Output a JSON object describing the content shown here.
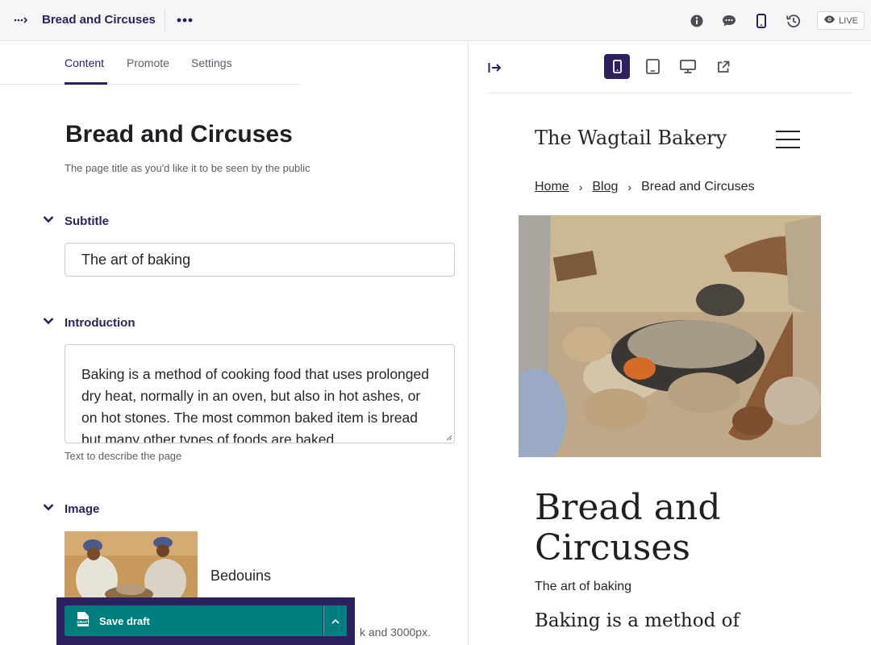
{
  "header": {
    "page_name": "Bread and Circuses",
    "live_label": "LIVE",
    "icons": [
      "breadcrumb-toggle-icon",
      "more-icon",
      "info-icon",
      "comment-icon",
      "mobile-preview-icon",
      "history-icon",
      "eye-icon"
    ]
  },
  "editor": {
    "tabs": [
      {
        "label": "Content",
        "active": true
      },
      {
        "label": "Promote",
        "active": false
      },
      {
        "label": "Settings",
        "active": false
      }
    ],
    "title_value": "Bread and Circuses",
    "title_help": "The page title as you'd like it to be seen by the public",
    "subtitle": {
      "label": "Subtitle",
      "value": "The art of baking"
    },
    "introduction": {
      "label": "Introduction",
      "value": "Baking is a method of cooking food that uses prolonged dry heat, normally in an oven, but also in hot ashes, or on hot stones. The most common baked item is bread but many other types of foods are baked.",
      "help": "Text to describe the page"
    },
    "image": {
      "label": "Image",
      "name": "Bedouins",
      "help_tail": "k and 3000px."
    },
    "actions": {
      "save_label": "Save draft"
    }
  },
  "preview": {
    "site_name": "The Wagtail Bakery",
    "breadcrumb": [
      "Home",
      "Blog",
      "Bread and Circuses"
    ],
    "title": "Bread and Circuses",
    "subtitle": "The art of baking",
    "intro_start": "Baking is a method of"
  },
  "colors": {
    "primary": "#2e1f5e",
    "save": "#007d7e",
    "header_bg": "#f6f6f8"
  }
}
